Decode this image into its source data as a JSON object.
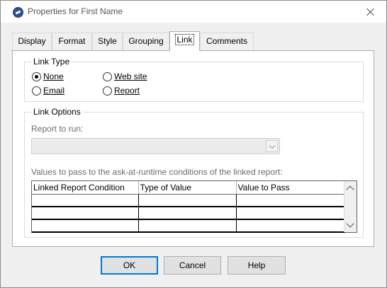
{
  "window": {
    "title": "Properties for First Name"
  },
  "tabs": [
    {
      "label": "Display"
    },
    {
      "label": "Format"
    },
    {
      "label": "Style"
    },
    {
      "label": "Grouping"
    },
    {
      "label": "Link"
    },
    {
      "label": "Comments"
    }
  ],
  "active_tab": "Link",
  "link_type": {
    "legend": "Link Type",
    "options": [
      {
        "label": "None",
        "selected": true
      },
      {
        "label": "Web site",
        "selected": false
      },
      {
        "label": "Email",
        "selected": false
      },
      {
        "label": "Report",
        "selected": false
      }
    ]
  },
  "link_options": {
    "legend": "Link Options",
    "report_label": "Report to run:",
    "report_value": "",
    "values_label": "Values to pass to the ask-at-runtime conditions of the linked report:",
    "grid": {
      "columns": [
        "Linked Report Condition",
        "Type of Value",
        "Value to Pass"
      ],
      "rows": [
        [
          "",
          "",
          ""
        ],
        [
          "",
          "",
          ""
        ],
        [
          "",
          "",
          ""
        ]
      ]
    }
  },
  "buttons": {
    "ok": "OK",
    "cancel": "Cancel",
    "help": "Help"
  },
  "colors": {
    "accent": "#0078d7",
    "panel": "#ffffff",
    "dialog": "#f0f0f0"
  },
  "icons": {
    "app": "app-globe-icon",
    "close": "close-icon"
  }
}
